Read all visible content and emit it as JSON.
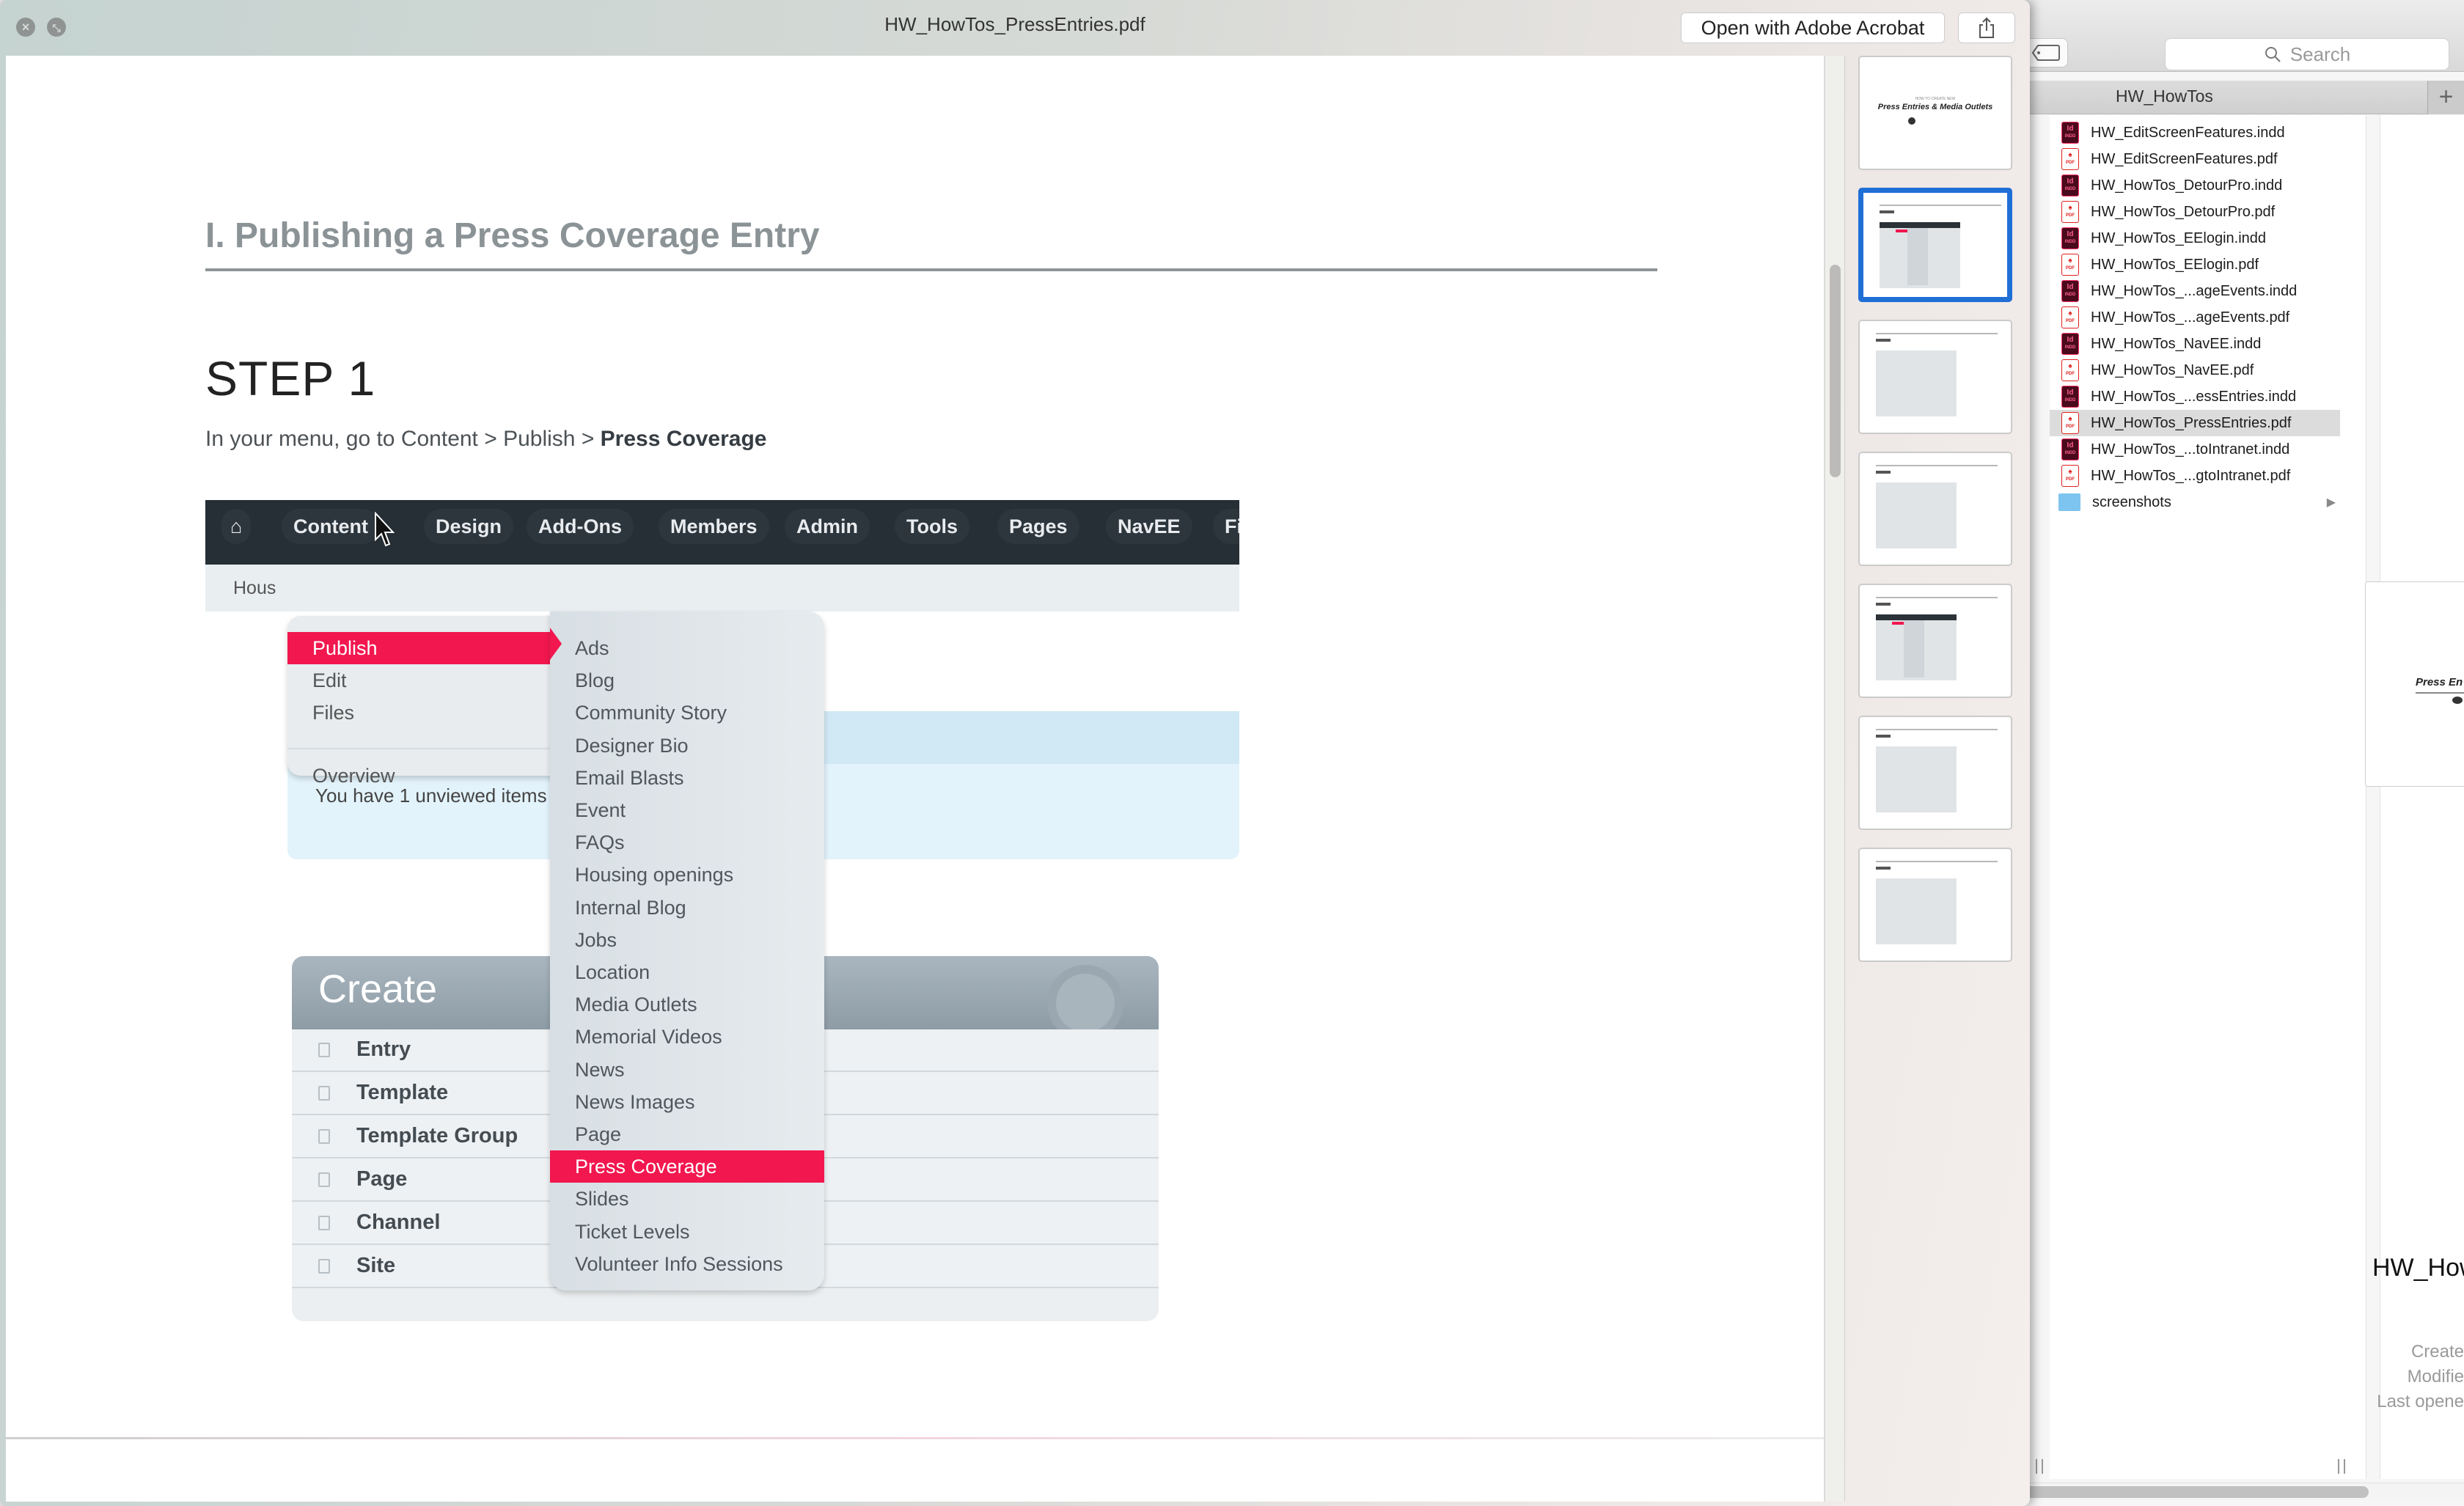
{
  "quicklook": {
    "title": "HW_HowTos_PressEntries.pdf",
    "open_button": "Open with Adobe Acrobat",
    "share_icon": "share-icon",
    "close_icon": "close-icon",
    "fullscreen_icon": "fullscreen-icon"
  },
  "document": {
    "section_title": "I. Publishing a Press Coverage Entry",
    "step_title": "STEP 1",
    "instruction_prefix": "In your menu, go to Content > Publish > ",
    "instruction_bold": "Press Coverage",
    "screenshot": {
      "nav_items": [
        "Content",
        "Design",
        "Add-Ons",
        "Members",
        "Admin",
        "Tools",
        "Pages",
        "NavEE",
        "Fil"
      ],
      "breadcrumb": "Hous",
      "unviewed_text": "You have 1 unviewed items",
      "primary_menu": [
        {
          "label": "Publish",
          "active": true
        },
        {
          "label": "Edit",
          "submenu": true
        },
        {
          "label": "Files",
          "submenu": true
        },
        {
          "label": "Overview"
        }
      ],
      "publish_submenu": [
        "Ads",
        "Blog",
        "Community Story",
        "Designer Bio",
        "Email Blasts",
        "Event",
        "FAQs",
        "Housing openings",
        "Internal Blog",
        "Jobs",
        "Location",
        "Media Outlets",
        "Memorial Videos",
        "News",
        "News Images",
        "Page",
        "Press Coverage",
        "Slides",
        "Ticket Levels",
        "Volunteer Info Sessions"
      ],
      "publish_submenu_active": "Press Coverage",
      "create_panel": {
        "title": "Create",
        "items": [
          "Entry",
          "Template",
          "Template Group",
          "Page",
          "Channel",
          "Site"
        ]
      }
    }
  },
  "thumbnails": {
    "count": 7,
    "active_index": 1,
    "cover_small": "HOW TO CREATE NEW",
    "cover_title": "Press Entries & Media Outlets"
  },
  "finder": {
    "search_placeholder": "Search",
    "folder_title": "HW_HowTos",
    "add_tab": "+",
    "files": [
      {
        "name": "HW_EditScreenFeatures.indd",
        "type": "indd"
      },
      {
        "name": "HW_EditScreenFeatures.pdf",
        "type": "pdf"
      },
      {
        "name": "HW_HowTos_DetourPro.indd",
        "type": "indd"
      },
      {
        "name": "HW_HowTos_DetourPro.pdf",
        "type": "pdf"
      },
      {
        "name": "HW_HowTos_EElogin.indd",
        "type": "indd"
      },
      {
        "name": "HW_HowTos_EElogin.pdf",
        "type": "pdf"
      },
      {
        "name": "HW_HowTos_...ageEvents.indd",
        "type": "indd"
      },
      {
        "name": "HW_HowTos_...ageEvents.pdf",
        "type": "pdf"
      },
      {
        "name": "HW_HowTos_NavEE.indd",
        "type": "indd"
      },
      {
        "name": "HW_HowTos_NavEE.pdf",
        "type": "pdf"
      },
      {
        "name": "HW_HowTos_...essEntries.indd",
        "type": "indd"
      },
      {
        "name": "HW_HowTos_PressEntries.pdf",
        "type": "pdf",
        "selected": true
      },
      {
        "name": "HW_HowTos_...toIntranet.indd",
        "type": "indd"
      },
      {
        "name": "HW_HowTos_...gtoIntranet.pdf",
        "type": "pdf"
      },
      {
        "name": "screenshots",
        "type": "folder"
      }
    ],
    "preview": {
      "thumb_text": "Press En",
      "name": "HW_How",
      "created_label": "Create",
      "modified_label": "Modifie",
      "last_opened_label": "Last opene"
    }
  }
}
